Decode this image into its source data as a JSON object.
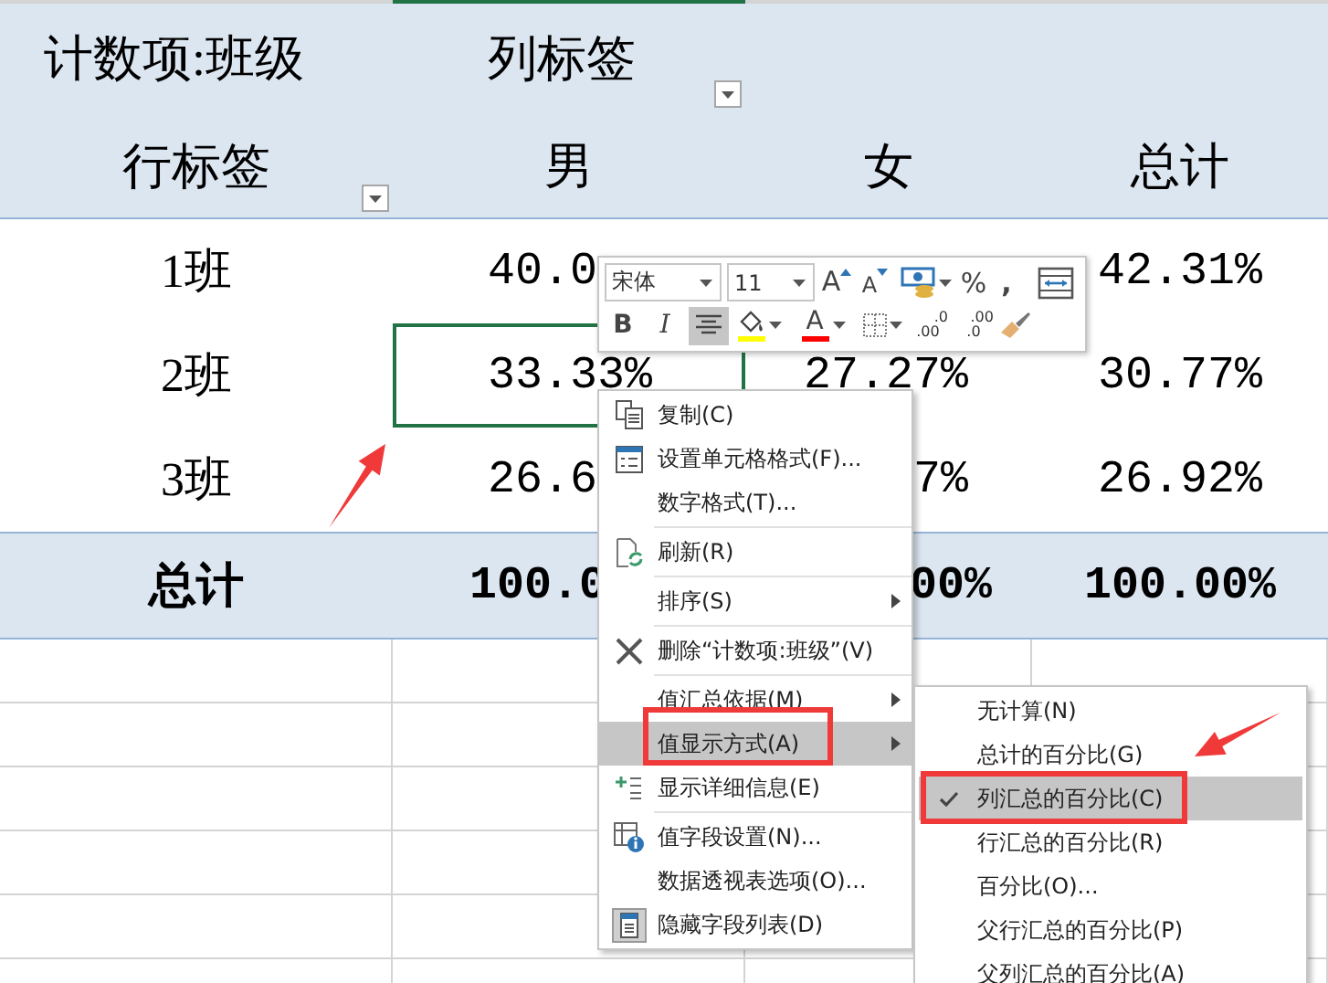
{
  "pivot": {
    "value_field": "计数项:班级",
    "column_label": "列标签",
    "row_label": "行标签",
    "columns": [
      "男",
      "女",
      "总计"
    ],
    "rows": [
      {
        "label": "1班",
        "male": "40.0",
        "total": "42.31%",
        "selected": false
      },
      {
        "label": "2班",
        "male": "33.33%",
        "female": "27.27%",
        "total": "30.77%",
        "selected": true
      },
      {
        "label": "3班",
        "male": "26.6",
        "female": "7%",
        "total": "26.92%",
        "selected": false
      }
    ],
    "total": {
      "label": "总计",
      "values": [
        "100.0",
        "00%",
        "100.00%"
      ]
    }
  },
  "mini_toolbar": {
    "rows": [
      [
        {
          "kind": "font-box",
          "value": "宋体"
        },
        {
          "kind": "size-box",
          "value": "11"
        },
        {
          "kind": "grow-font",
          "text": "A"
        },
        {
          "kind": "shrink-font",
          "text": "A"
        },
        {
          "kind": "accounting"
        },
        {
          "kind": "percent",
          "text": "%"
        },
        {
          "kind": "comma",
          "text": ","
        },
        {
          "kind": "wrap"
        }
      ],
      [
        {
          "kind": "bold",
          "text": "B",
          "selected": false
        },
        {
          "kind": "italic",
          "text": "I",
          "selected": false
        },
        {
          "kind": "align-center",
          "selected": true
        },
        {
          "kind": "fill-color",
          "color": "#ffff00"
        },
        {
          "kind": "font-color",
          "text": "A",
          "color": "#ff0000"
        },
        {
          "kind": "borders"
        },
        {
          "kind": "increase-decimal",
          "top": ".0",
          "bottom": ".00"
        },
        {
          "kind": "decrease-decimal",
          "top": ".00",
          "bottom": ".0"
        },
        {
          "kind": "format-painter"
        }
      ]
    ]
  },
  "context_menu": {
    "groups": [
      [
        {
          "kind": "copy",
          "label": "复制(C)",
          "submenu": false,
          "selected": false
        },
        {
          "kind": "format-cells",
          "label": "设置单元格格式(F)...",
          "submenu": false,
          "selected": false
        },
        {
          "kind": "plain",
          "label": "数字格式(T)...",
          "submenu": false,
          "selected": false
        }
      ],
      [
        {
          "kind": "refresh",
          "label": "刷新(R)",
          "submenu": false,
          "selected": false
        }
      ],
      [
        {
          "kind": "plain",
          "label": "排序(S)",
          "submenu": true,
          "selected": false
        }
      ],
      [
        {
          "kind": "delete",
          "label": "删除“计数项:班级”(V)",
          "submenu": false,
          "selected": false
        }
      ],
      [
        {
          "kind": "plain",
          "label": "值汇总依据(M)",
          "submenu": true,
          "selected": false
        },
        {
          "kind": "plain",
          "label": "值显示方式(A)",
          "submenu": true,
          "selected": true
        },
        {
          "kind": "details",
          "label": "显示详细信息(E)",
          "submenu": false,
          "selected": false
        }
      ],
      [
        {
          "kind": "field-settings",
          "label": "值字段设置(N)...",
          "submenu": false,
          "selected": false
        },
        {
          "kind": "plain",
          "label": "数据透视表选项(O)...",
          "submenu": false,
          "selected": false
        },
        {
          "kind": "field-list",
          "label": "隐藏字段列表(D)",
          "submenu": false,
          "selected": false
        }
      ]
    ]
  },
  "submenu": {
    "items": [
      {
        "label": "无计算(N)",
        "checked": false,
        "selected": false
      },
      {
        "label": "总计的百分比(G)",
        "checked": false,
        "selected": false
      },
      {
        "label": "列汇总的百分比(C)",
        "checked": true,
        "selected": true
      },
      {
        "label": "行汇总的百分比(R)",
        "checked": false,
        "selected": false
      },
      {
        "label": "百分比(O)...",
        "checked": false,
        "selected": false
      },
      {
        "label": "父行汇总的百分比(P)",
        "checked": false,
        "selected": false
      },
      {
        "label": "父列汇总的百分比(A)",
        "checked": false,
        "selected": false
      }
    ]
  }
}
